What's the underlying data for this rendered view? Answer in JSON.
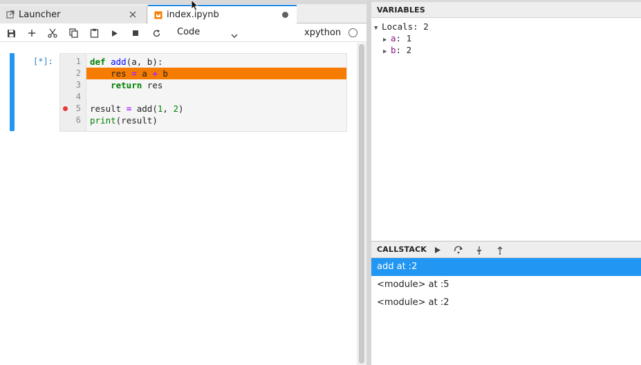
{
  "tabs": [
    {
      "label": "Launcher",
      "icon": "launch-icon"
    },
    {
      "label": "index.ipynb",
      "icon": "notebook-icon",
      "modified": true
    }
  ],
  "toolbar": {
    "cell_type": "Code",
    "kernel_name": "xpython",
    "buttons": [
      "save-icon",
      "add-icon",
      "cut-icon",
      "copy-icon",
      "paste-icon",
      "run-icon",
      "stop-icon",
      "restart-icon"
    ]
  },
  "cell": {
    "prompt": "[*]:",
    "line_numbers": [
      "1",
      "2",
      "3",
      "4",
      "5",
      "6"
    ],
    "lines": [
      "def add(a, b):",
      "    res = a + b",
      "    return res",
      "",
      "result = add(1, 2)",
      "print(result)"
    ],
    "highlighted_line": 2,
    "breakpoint_line": 5
  },
  "variables": {
    "title": "VARIABLES",
    "scope_label": "Locals: 2",
    "items": [
      {
        "name": "a",
        "value": "1"
      },
      {
        "name": "b",
        "value": "2"
      }
    ]
  },
  "callstack": {
    "title": "CALLSTACK",
    "buttons": [
      "continue-icon",
      "step-over-icon",
      "step-in-icon",
      "step-out-icon"
    ],
    "frames": [
      {
        "label": "add at :2",
        "selected": true
      },
      {
        "label": "<module> at :5",
        "selected": false
      },
      {
        "label": "<module> at :2",
        "selected": false
      }
    ]
  },
  "colors": {
    "accent": "#2196f3",
    "highlight_line": "#f57c00",
    "breakpoint": "#e53935"
  }
}
